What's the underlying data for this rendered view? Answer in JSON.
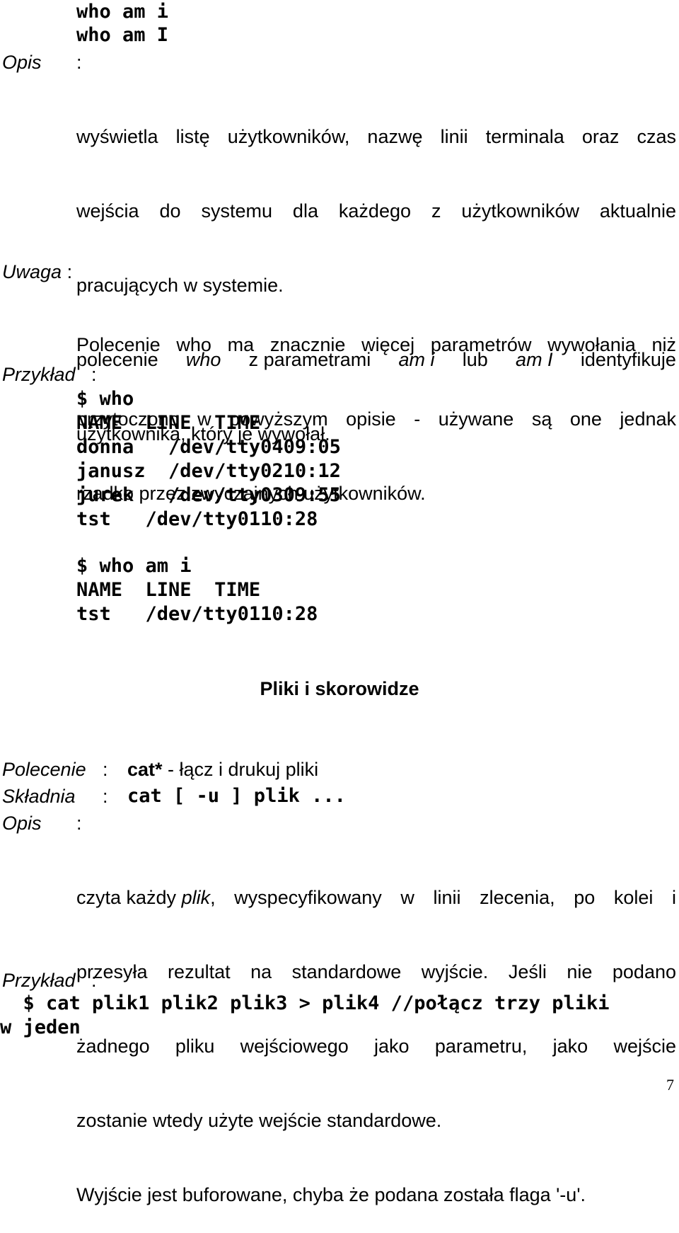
{
  "who_section": {
    "syntax_lines": [
      "who am i",
      "who am I"
    ],
    "opis_label": "Opis",
    "colon": ":",
    "description_lines": [
      "wyświetla listę użytkowników, nazwę linii terminala oraz czas",
      "wejścia do systemu dla każdego z użytkowników aktualnie",
      "pracujących w systemie."
    ],
    "identify_line": {
      "t1": "polecenie ",
      "t2": "who",
      "t3": " z parametrami ",
      "t4": "am i",
      "t5": " lub ",
      "t6": "am I",
      "t7": " identyfikuje"
    },
    "identify_last": "użytkownika, który je wywołał.",
    "uwaga_label": "Uwaga",
    "uwaga_lines": [
      "Polecenie who ma znacznie więcej parametrów wywołania niż",
      "przytoczono w powyższym opisie - używane są one jednak",
      "rzadko przez zwyczajnych użytkowników."
    ],
    "przyklad_label": "Przykład",
    "example1": {
      "prompt": "$ who",
      "header": "NAME  LINE  TIME",
      "rows": [
        "donna   /dev/tty0409:05",
        "janusz  /dev/tty0210:12",
        "jurek   /dev/tty0309:55",
        "tst   /dev/tty0110:28"
      ]
    },
    "example2": {
      "prompt": "$ who am i",
      "header": "NAME  LINE  TIME",
      "rows": [
        "tst   /dev/tty0110:28"
      ]
    }
  },
  "section_heading": "Pliki i skorowidze",
  "cat_section": {
    "polecenie_label": "Polecenie",
    "command_name": "cat*",
    "command_desc": " - łącz i drukuj pliki",
    "skladnia_label": "Składnia",
    "syntax": "cat [ -u ] plik ...",
    "opis_label": "Opis",
    "colon": ":",
    "desc_line1": {
      "t1": "czyta każdy ",
      "t2": "plik",
      "t3": ", wyspecyfikowany w linii zlecenia, po kolei i"
    },
    "desc_lines": [
      "przesyła rezultat na standardowe wyjście. Jeśli nie podano",
      "żadnego pliku wejściowego jako parametru, jako wejście",
      "zostanie wtedy użyte wejście standardowe."
    ],
    "buffer_note": "Wyjście jest buforowane, chyba że podana została flaga '-u'.",
    "przyklad_label": "Przykład",
    "example_line1": "  $ cat plik1 plik2 plik3 > plik4 //połącz trzy pliki",
    "example_line2": "w jeden"
  },
  "page_number": "7"
}
